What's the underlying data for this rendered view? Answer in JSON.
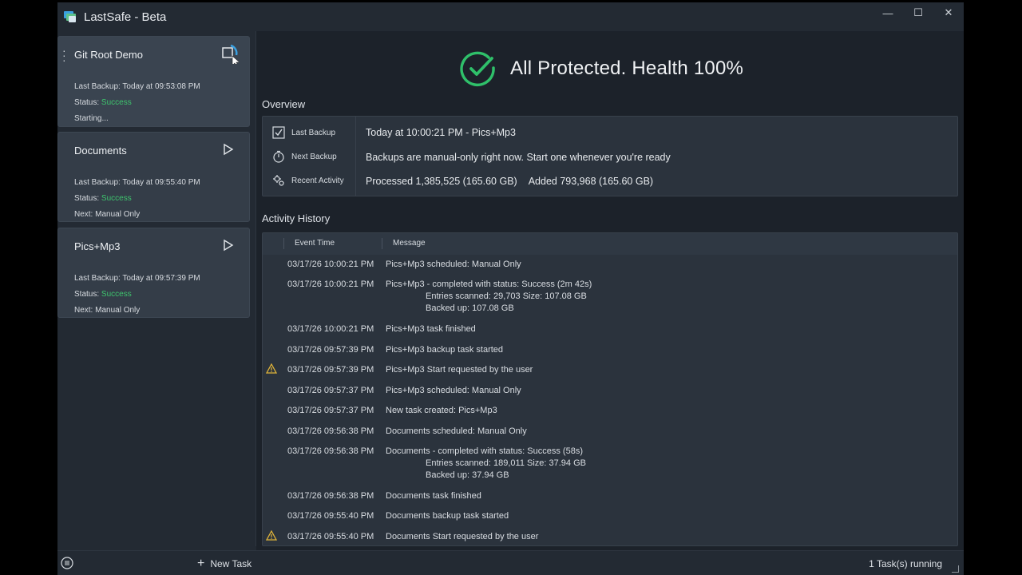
{
  "window": {
    "title": "LastSafe - Beta",
    "controls": {
      "minimize": "—",
      "maximize": "☐",
      "close": "✕"
    }
  },
  "sidebar": {
    "tasks": [
      {
        "name": "Git Root Demo",
        "last_backup": "Last Backup: Today at 09:53:08 PM",
        "status_label": "Status:",
        "status_value": "Success",
        "third_line": "Starting...",
        "action_icon": "stop-icon",
        "state": "running"
      },
      {
        "name": "Documents",
        "last_backup": "Last Backup: Today at 09:55:40 PM",
        "status_label": "Status:",
        "status_value": "Success",
        "third_line": "Next: Manual Only",
        "action_icon": "play-icon",
        "state": "idle"
      },
      {
        "name": "Pics+Mp3",
        "last_backup": "Last Backup: Today at 09:57:39 PM",
        "status_label": "Status:",
        "status_value": "Success",
        "third_line": "Next: Manual Only",
        "action_icon": "play-icon",
        "state": "idle"
      }
    ]
  },
  "health": {
    "text": "All Protected. Health 100%",
    "color": "#2fc06a"
  },
  "overview": {
    "title": "Overview",
    "last_backup_label": "Last Backup",
    "last_backup_value": "Today at 10:00:21 PM - Pics+Mp3",
    "next_backup_label": "Next Backup",
    "next_backup_value": "Backups are manual-only right now. Start one whenever you're ready",
    "recent_activity_label": "Recent Activity",
    "processed": "Processed 1,385,525 (165.60 GB)",
    "added": "Added 793,968 (165.60 GB)"
  },
  "history": {
    "title": "Activity History",
    "col_time": "Event Time",
    "col_message": "Message",
    "rows": [
      {
        "time": "03/17/26 10:00:21 PM",
        "message": "Pics+Mp3 scheduled: Manual Only",
        "warn": false
      },
      {
        "time": "03/17/26 10:00:21 PM",
        "message": "Pics+Mp3 - completed with status: Success (2m 42s)",
        "sub1": "Entries scanned: 29,703 Size: 107.08 GB",
        "sub2": "Backed up: 107.08 GB",
        "warn": false
      },
      {
        "time": "03/17/26 10:00:21 PM",
        "message": "Pics+Mp3 task finished",
        "warn": false
      },
      {
        "time": "03/17/26 09:57:39 PM",
        "message": "Pics+Mp3 backup task started",
        "warn": false
      },
      {
        "time": "03/17/26 09:57:39 PM",
        "message": "Pics+Mp3 Start requested by the user",
        "warn": true
      },
      {
        "time": "03/17/26 09:57:37 PM",
        "message": "Pics+Mp3 scheduled: Manual Only",
        "warn": false
      },
      {
        "time": "03/17/26 09:57:37 PM",
        "message": "New task created: Pics+Mp3",
        "warn": false
      },
      {
        "time": "03/17/26 09:56:38 PM",
        "message": "Documents scheduled: Manual Only",
        "warn": false
      },
      {
        "time": "03/17/26 09:56:38 PM",
        "message": "Documents - completed with status: Success (58s)",
        "sub1": "Entries scanned: 189,011 Size: 37.94 GB",
        "sub2": "Backed up: 37.94 GB",
        "warn": false
      },
      {
        "time": "03/17/26 09:56:38 PM",
        "message": "Documents task finished",
        "warn": false
      },
      {
        "time": "03/17/26 09:55:40 PM",
        "message": "Documents backup task started",
        "warn": false
      },
      {
        "time": "03/17/26 09:55:40 PM",
        "message": "Documents Start requested by the user",
        "warn": true
      }
    ]
  },
  "statusbar": {
    "new_task_label": "New Task",
    "running_text": "1 Task(s) running"
  },
  "colors": {
    "accent": "#3aa0e0",
    "success": "#3ec46d",
    "warning": "#e0b43a"
  }
}
